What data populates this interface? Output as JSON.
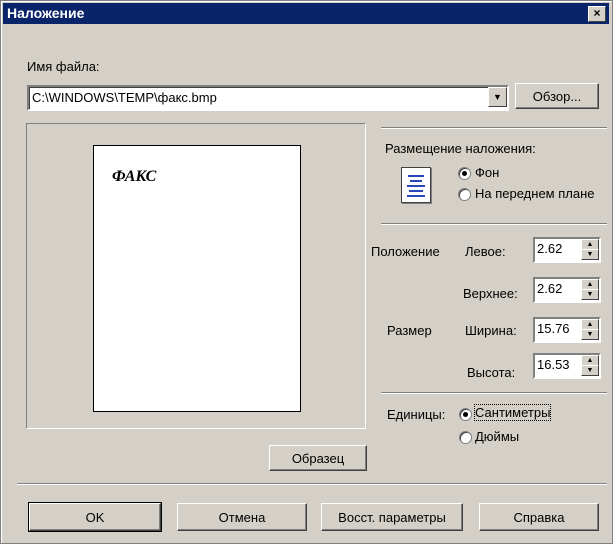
{
  "window": {
    "title": "Наложение",
    "close_glyph": "×"
  },
  "file": {
    "label": "Имя файла:",
    "path": "C:\\WINDOWS\\TEMP\\факс.bmp",
    "browse_label": "Обзор..."
  },
  "preview": {
    "page_text": "ФАКС",
    "sample_label": "Образец"
  },
  "placement": {
    "label": "Размещение наложения:",
    "option_background": "Фон",
    "option_foreground": "На переднем плане",
    "selected": "Фон"
  },
  "position": {
    "label": "Положение",
    "left_label": "Левое:",
    "left_value": "2.62",
    "top_label": "Верхнее:",
    "top_value": "2.62"
  },
  "size": {
    "label": "Размер",
    "width_label": "Ширина:",
    "width_value": "15.76",
    "height_label": "Высота:",
    "height_value": "16.53"
  },
  "units": {
    "label": "Единицы:",
    "option_cm": "Сантиметры",
    "option_in": "Дюймы",
    "selected": "Сантиметры"
  },
  "footer": {
    "ok_label": "OK",
    "cancel_label": "Отмена",
    "restore_label": "Восст. параметры",
    "help_label": "Справка"
  },
  "colors": {
    "titlebar": "#0a246a",
    "face": "#d4d0c8"
  }
}
